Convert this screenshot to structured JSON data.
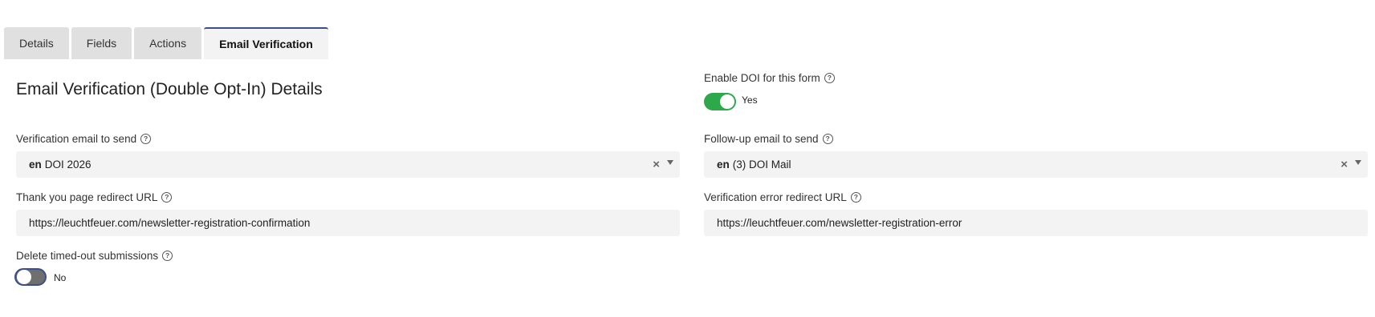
{
  "tabs": [
    {
      "label": "Details"
    },
    {
      "label": "Fields"
    },
    {
      "label": "Actions"
    },
    {
      "label": "Email Verification"
    }
  ],
  "page_title": "Email Verification (Double Opt-In) Details",
  "enable_doi": {
    "label": "Enable DOI for this form",
    "state": "Yes",
    "on": true
  },
  "verification_email": {
    "label": "Verification email to send",
    "lang": "en",
    "value": "DOI 2026"
  },
  "followup_email": {
    "label": "Follow-up email to send",
    "lang": "en",
    "value": "(3) DOI Mail"
  },
  "thankyou_url": {
    "label": "Thank you page redirect URL",
    "value": "https://leuchtfeuer.com/newsletter-registration-confirmation"
  },
  "error_url": {
    "label": "Verification error redirect URL",
    "value": "https://leuchtfeuer.com/newsletter-registration-error"
  },
  "delete_timed_out": {
    "label": "Delete timed-out submissions",
    "state": "No",
    "on": false
  },
  "icons": {
    "help": "question-circle-icon",
    "clear": "clear-x-icon",
    "caret": "caret-down-icon"
  },
  "colors": {
    "toggle_on": "#2da84a",
    "toggle_off": "#6f6f6f",
    "active_tab_border": "#3b4f8a",
    "field_bg": "#f3f3f3"
  }
}
